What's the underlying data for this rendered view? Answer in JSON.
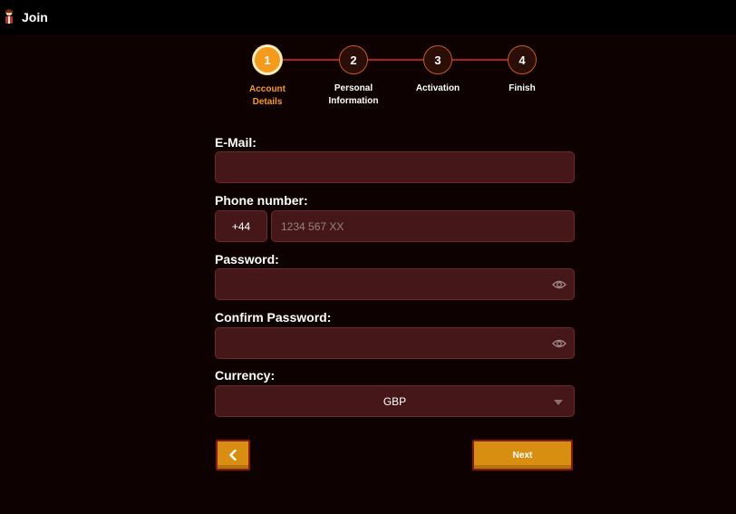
{
  "window": {
    "title": "Join",
    "icon": "user-avatar-icon"
  },
  "stepper": {
    "steps": [
      {
        "number": "1",
        "label_line1": "Account",
        "label_line2": "Details",
        "active": true
      },
      {
        "number": "2",
        "label_line1": "Personal",
        "label_line2": "Information",
        "active": false
      },
      {
        "number": "3",
        "label_line1": "Activation",
        "label_line2": "",
        "active": false
      },
      {
        "number": "4",
        "label_line1": "Finish",
        "label_line2": "",
        "active": false
      }
    ]
  },
  "form": {
    "email": {
      "label": "E-Mail:",
      "value": "",
      "placeholder": ""
    },
    "phone": {
      "label": "Phone number:",
      "prefix": "+44",
      "value": "",
      "placeholder": "1234 567 XX"
    },
    "password": {
      "label": "Password:",
      "value": "",
      "toggle_icon": "eye-icon"
    },
    "confirm_password": {
      "label": "Confirm Password:",
      "value": "",
      "toggle_icon": "eye-icon"
    },
    "currency": {
      "label": "Currency:",
      "selected": "GBP"
    }
  },
  "actions": {
    "back_icon": "chevron-left-icon",
    "next_label": "Next"
  },
  "colors": {
    "background": "#0d0101",
    "accent": "#f59a1b",
    "field_bg": "#451718",
    "button_bg": "#d88e10",
    "step_line": "#a8231c"
  }
}
